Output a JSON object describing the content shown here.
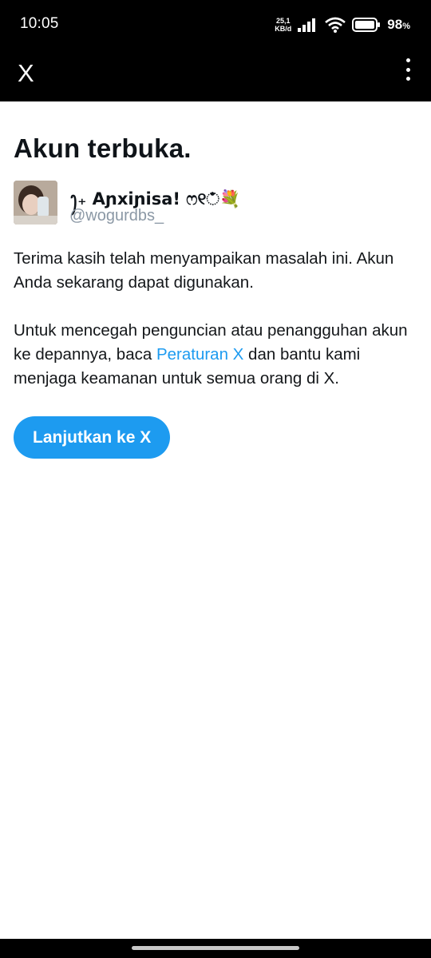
{
  "status_bar": {
    "time": "10:05",
    "net_speed_value": "25,1",
    "net_speed_unit": "KB/d",
    "battery_percent": "98",
    "battery_unit": "%"
  },
  "app_bar": {
    "logo": "X",
    "menu_icon": "kebab-menu-icon"
  },
  "main": {
    "title": "Akun terbuka.",
    "user": {
      "display_name": "ꫂ₊ Aɲxiɲisa! ෆ୧ಁ💐",
      "handle": "@wogurdbs_"
    },
    "paragraph1": "Terima kasih telah menyampaikan masalah ini. Akun Anda sekarang dapat digunakan.",
    "paragraph2_before": "Untuk mencegah penguncian atau penangguhan akun ke depannya, baca ",
    "paragraph2_link": "Peraturan X",
    "paragraph2_after": " dan bantu kami menjaga keamanan untuk semua orang di X.",
    "continue_button": "Lanjutkan ke X"
  },
  "colors": {
    "accent": "#1d9bf0",
    "bar_background": "#000000",
    "handle_text": "#8b98a5"
  }
}
